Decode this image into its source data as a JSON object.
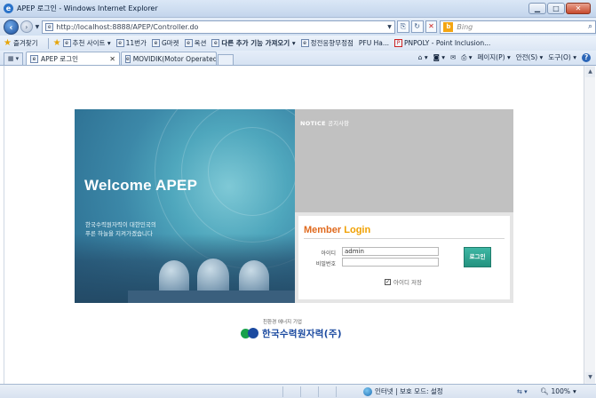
{
  "window": {
    "title": "APEP 로그인 - Windows Internet Explorer",
    "buttons": {
      "minimize": "▁",
      "maximize": "□",
      "close": "✕"
    }
  },
  "address": {
    "url": "http://localhost:8888/APEP/Controller.do",
    "search_placeholder": "Bing",
    "search_engine_badge": "b"
  },
  "favorites": {
    "label": "즐겨찾기",
    "items": [
      {
        "label": "추천 사이트 ▾"
      },
      {
        "label": "11번가"
      },
      {
        "label": "G마켓"
      },
      {
        "label": "옥션"
      },
      {
        "label": "다른 추가 기능 가져오기 ▾"
      },
      {
        "label": "정전응향무정점"
      },
      {
        "label": "PFU Ha..."
      },
      {
        "label": "PNPOLY - Point Inclusion..."
      }
    ]
  },
  "tabs": [
    {
      "label": "APEP 로그인",
      "close": "✕"
    },
    {
      "label": "MOVIDIK(Motor Operated..."
    }
  ],
  "command_bar": {
    "page": "페이지(P) ▾",
    "safety": "안전(S) ▾",
    "tools": "도구(O) ▾",
    "help": "?"
  },
  "page": {
    "hero": {
      "welcome": "Welcome APEP",
      "subtitle_line1": "한국수력원자력이 대한민국의",
      "subtitle_line2": "푸른 하늘을 지켜가겠습니다"
    },
    "notice": {
      "title_en": "NOTICE",
      "title_ko": "공지사항"
    },
    "login": {
      "title_member": "Member",
      "title_login": "Login",
      "id_label": "아이디",
      "id_value": "admin",
      "pw_label": "비밀번호",
      "pw_value": "",
      "button": "로그인",
      "save_id_label": "아이디 저장",
      "save_id_checked": "✓"
    },
    "footer": {
      "tagline": "친환경 에너지 기업",
      "company": "한국수력원자력(주)"
    }
  },
  "status": {
    "zone": "인터넷 | 보호 모드: 설정",
    "zoom": "100%"
  }
}
